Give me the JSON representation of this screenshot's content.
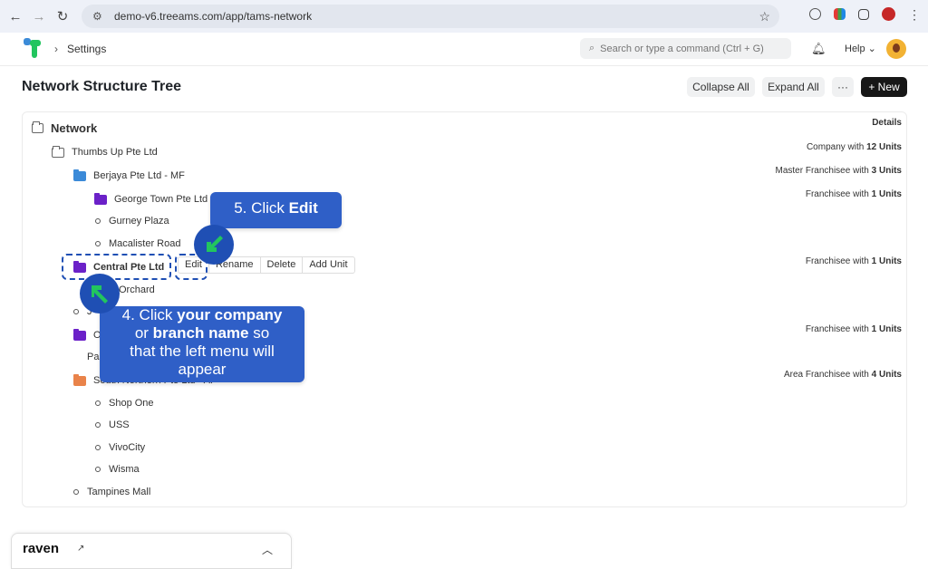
{
  "browser": {
    "url": "demo-v6.treeams.com/app/tams-network"
  },
  "header": {
    "breadcrumb": "Settings",
    "search_placeholder": "Search or type a command (Ctrl + G)",
    "help_label": "Help"
  },
  "page": {
    "title": "Network Structure Tree",
    "collapse_label": "Collapse All",
    "expand_label": "Expand All",
    "more_label": "···",
    "new_label": "+ New"
  },
  "tree": {
    "root_label": "Network",
    "details_label": "Details",
    "nodes": [
      {
        "label": "Thumbs Up Pte Ltd",
        "info_prefix": "Company with",
        "info_value": "12 Units"
      },
      {
        "label": "Berjaya Pte Ltd - MF",
        "info_prefix": "Master Franchisee with",
        "info_value": "3 Units"
      },
      {
        "label": "George Town Pte Ltd",
        "info_prefix": "Franchisee with",
        "info_value": "1 Units"
      },
      {
        "label": "Gurney Plaza"
      },
      {
        "label": "Macalister Road"
      },
      {
        "label": "Central Pte Ltd",
        "info_prefix": "Franchisee with",
        "info_value": "1 Units"
      },
      {
        "label": "N Orchard"
      },
      {
        "label": "J"
      },
      {
        "label": "Oper",
        "info_prefix": "Franchisee with",
        "info_value": "1 Units"
      },
      {
        "label": "Pasir R"
      },
      {
        "label": "South Northern Pte Ltd - AF",
        "info_prefix": "Area Franchisee with",
        "info_value": "4 Units"
      },
      {
        "label": "Shop One"
      },
      {
        "label": "USS"
      },
      {
        "label": "VivoCity"
      },
      {
        "label": "Wisma"
      },
      {
        "label": "Tampines Mall"
      }
    ]
  },
  "context_menu": {
    "edit": "Edit",
    "rename": "Rename",
    "delete": "Delete",
    "add_unit": "Add Unit"
  },
  "tutorial": {
    "step5_prefix": "5. Click ",
    "step5_bold": "Edit",
    "step4_line1_prefix": "4. Click ",
    "step4_line1_bold": "your company",
    "step4_line2_prefix": "or ",
    "step4_line2_bold": "branch name",
    "step4_line2_suffix": " so",
    "step4_line3": "that the left menu will",
    "step4_line4": "appear"
  },
  "raven": {
    "name": "raven"
  },
  "colors": {
    "callout_blue": "#2f5fc7",
    "arrow_green": "#22c55e",
    "folder_blue": "#3b8ad8",
    "folder_purple": "#6b21c8",
    "folder_orange": "#e9834a"
  }
}
